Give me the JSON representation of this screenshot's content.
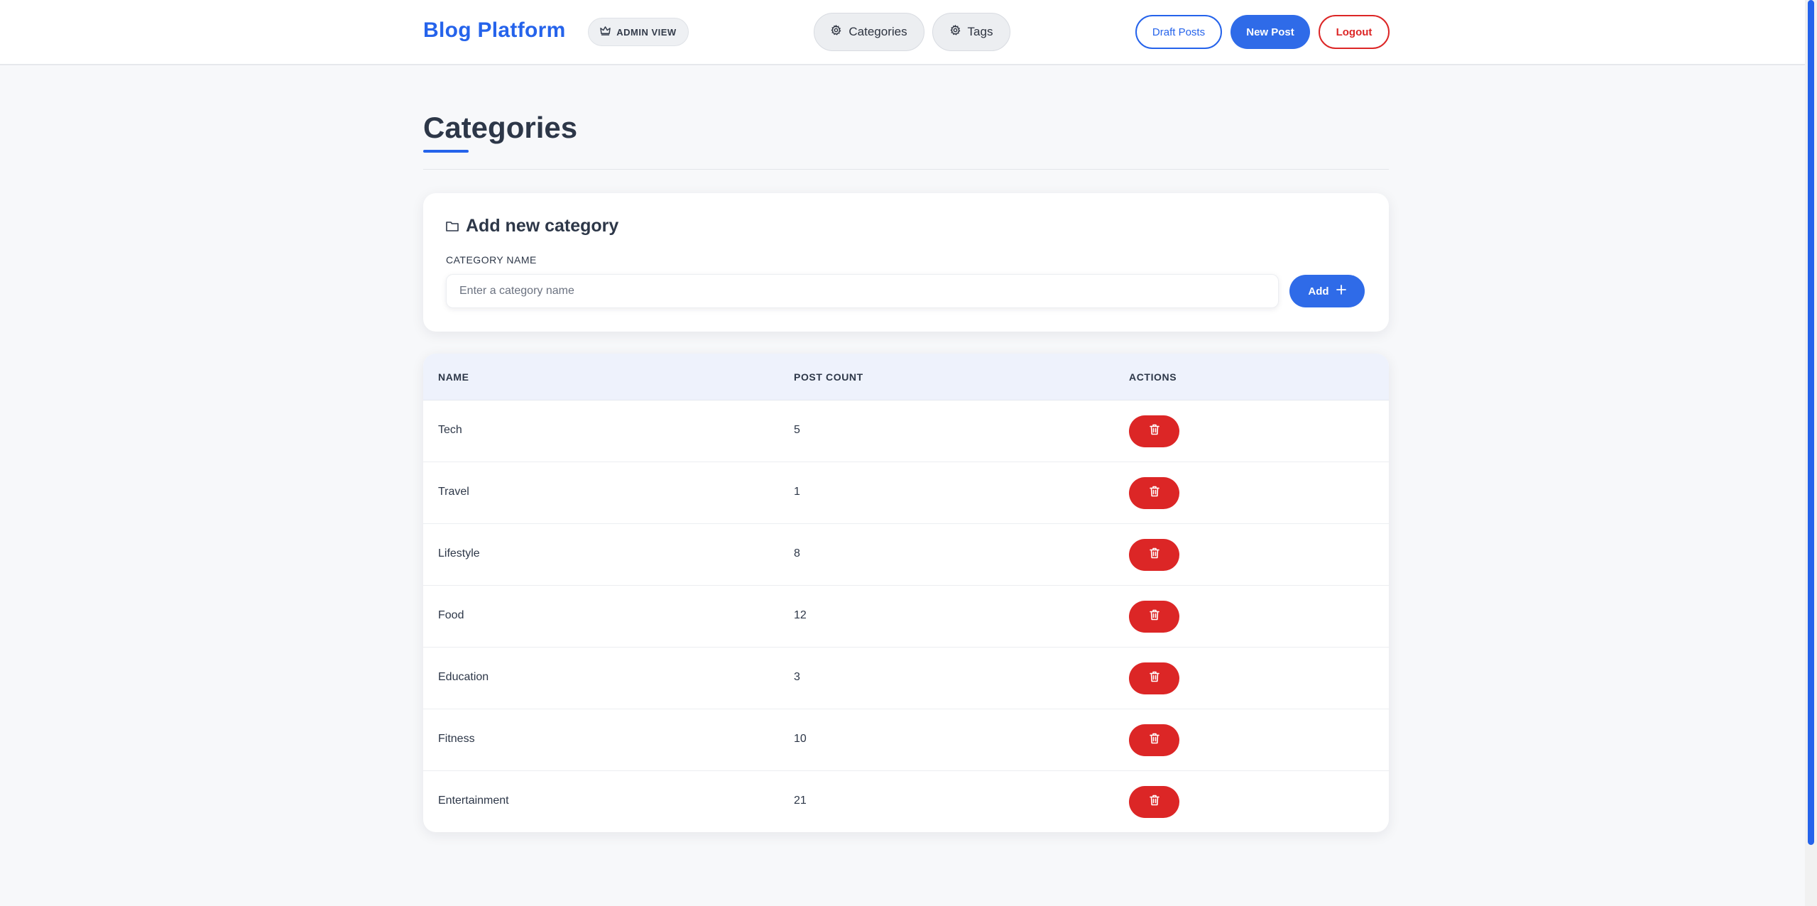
{
  "header": {
    "brand": "Blog Platform",
    "admin_badge": "ADMIN VIEW",
    "nav": [
      {
        "label": "Categories",
        "icon": "gear-icon"
      },
      {
        "label": "Tags",
        "icon": "gear-icon"
      }
    ],
    "draft_posts_label": "Draft Posts",
    "new_post_label": "New Post",
    "logout_label": "Logout"
  },
  "page": {
    "title": "Categories"
  },
  "add_form": {
    "heading": "Add new category",
    "field_label": "CATEGORY NAME",
    "placeholder": "Enter a category name",
    "value": "",
    "add_label": "Add"
  },
  "table": {
    "columns": [
      "NAME",
      "POST COUNT",
      "ACTIONS"
    ],
    "rows": [
      {
        "name": "Tech",
        "post_count": "5"
      },
      {
        "name": "Travel",
        "post_count": "1"
      },
      {
        "name": "Lifestyle",
        "post_count": "8"
      },
      {
        "name": "Food",
        "post_count": "12"
      },
      {
        "name": "Education",
        "post_count": "3"
      },
      {
        "name": "Fitness",
        "post_count": "10"
      },
      {
        "name": "Entertainment",
        "post_count": "21"
      }
    ]
  },
  "colors": {
    "accent": "#2563eb",
    "danger": "#dc2626",
    "background": "#f7f8fa"
  }
}
